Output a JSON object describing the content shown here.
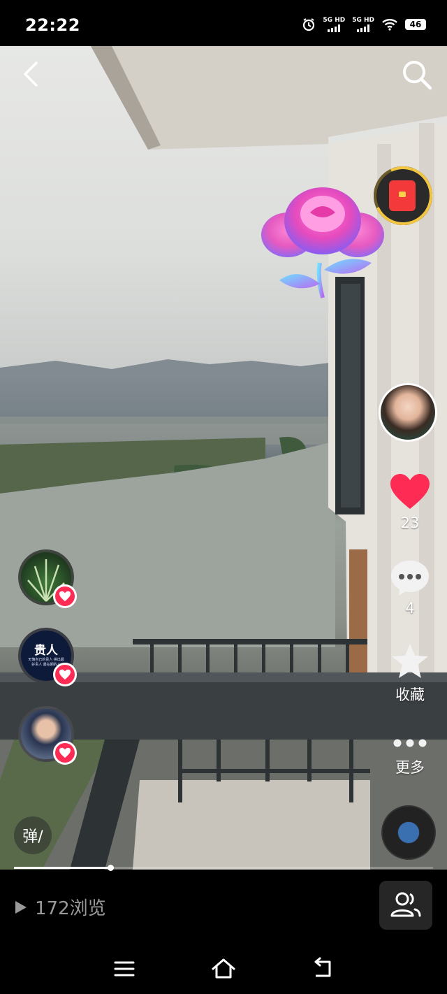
{
  "status_bar": {
    "time": "22:22",
    "network_1": "5G HD",
    "network_2": "5G HD",
    "battery": "46",
    "icons": [
      "alarm-icon",
      "signal-icon",
      "signal-icon",
      "wifi-icon",
      "battery-icon"
    ]
  },
  "top_bar": {
    "back_icon": "chevron-left-icon",
    "search_icon": "search-icon"
  },
  "side_actions": {
    "like_count": "23",
    "comment_count": "4",
    "favorite_label": "收藏",
    "more_label": "更多"
  },
  "gift_avatars": [
    {
      "kind": "plant-photo"
    },
    {
      "title": "贵人",
      "subtitle": "无愧自己的贵人 拼出最好贵人 最在期的人"
    },
    {
      "kind": "person-photo"
    }
  ],
  "danmu_label": "弹/",
  "video": {
    "progress": 0.23
  },
  "bottom": {
    "views_text": "172浏览"
  },
  "colors": {
    "accent_red": "#fe2c55",
    "heart_red": "#fe2c55",
    "redpacket_ring": "#f2c640",
    "muted_text": "#9a9a9a"
  }
}
